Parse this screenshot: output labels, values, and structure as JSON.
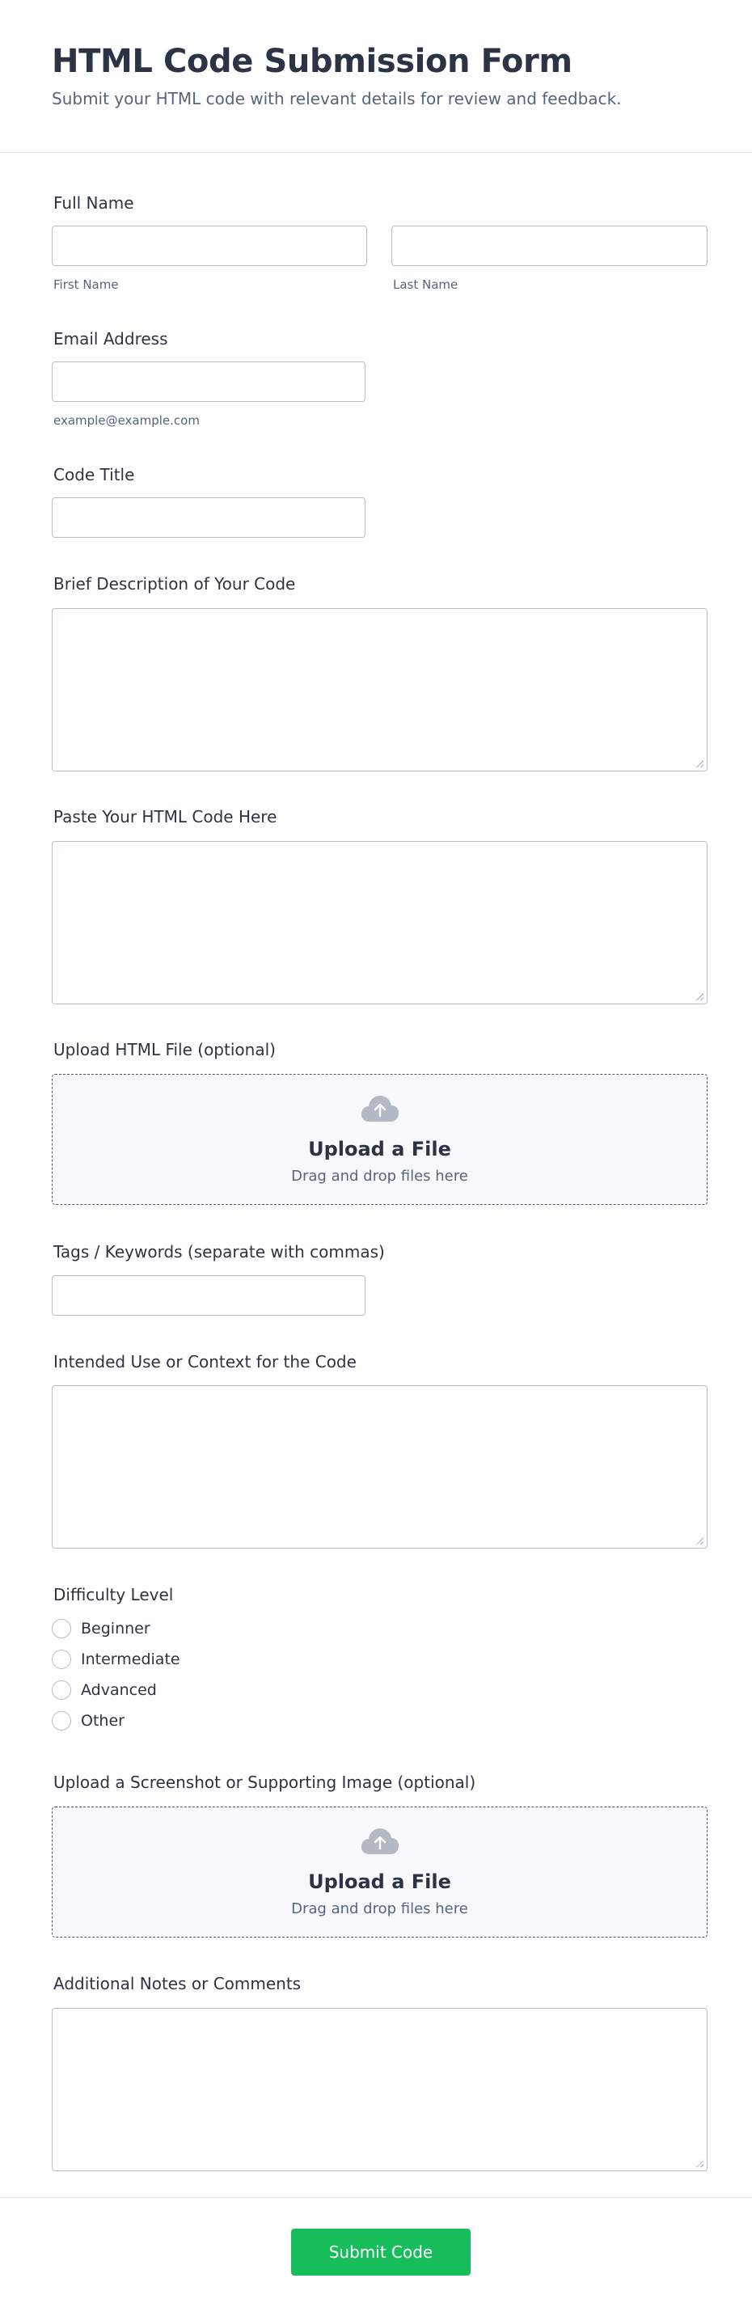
{
  "header": {
    "title": "HTML Code Submission Form",
    "subtitle": "Submit your HTML code with relevant details for review and feedback."
  },
  "fields": {
    "full_name": {
      "label": "Full Name",
      "first_value": "",
      "first_sublabel": "First Name",
      "last_value": "",
      "last_sublabel": "Last Name"
    },
    "email": {
      "label": "Email Address",
      "value": "",
      "sublabel": "example@example.com"
    },
    "code_title": {
      "label": "Code Title",
      "value": ""
    },
    "description": {
      "label": "Brief Description of Your Code",
      "value": ""
    },
    "html_code": {
      "label": "Paste Your HTML Code Here",
      "value": ""
    },
    "html_file": {
      "label": "Upload HTML File (optional)",
      "upload_title": "Upload a File",
      "upload_hint": "Drag and drop files here",
      "icon": "cloud-upload-icon"
    },
    "tags": {
      "label": "Tags / Keywords (separate with commas)",
      "value": ""
    },
    "intended_use": {
      "label": "Intended Use or Context for the Code",
      "value": ""
    },
    "difficulty": {
      "label": "Difficulty Level",
      "options": [
        "Beginner",
        "Intermediate",
        "Advanced",
        "Other"
      ],
      "selected": null
    },
    "screenshot": {
      "label": "Upload a Screenshot or Supporting Image (optional)",
      "upload_title": "Upload a File",
      "upload_hint": "Drag and drop files here",
      "icon": "cloud-upload-icon"
    },
    "notes": {
      "label": "Additional Notes or Comments",
      "value": ""
    }
  },
  "footer": {
    "submit_label": "Submit Code"
  },
  "colors": {
    "accent_button": "#18bd5b",
    "text_primary": "#2c3345",
    "text_secondary": "#57647e",
    "input_border": "#b8bdc9",
    "upload_border": "#4a5570",
    "upload_bg": "#f8f9fd",
    "upload_icon": "#b4b9c6"
  }
}
